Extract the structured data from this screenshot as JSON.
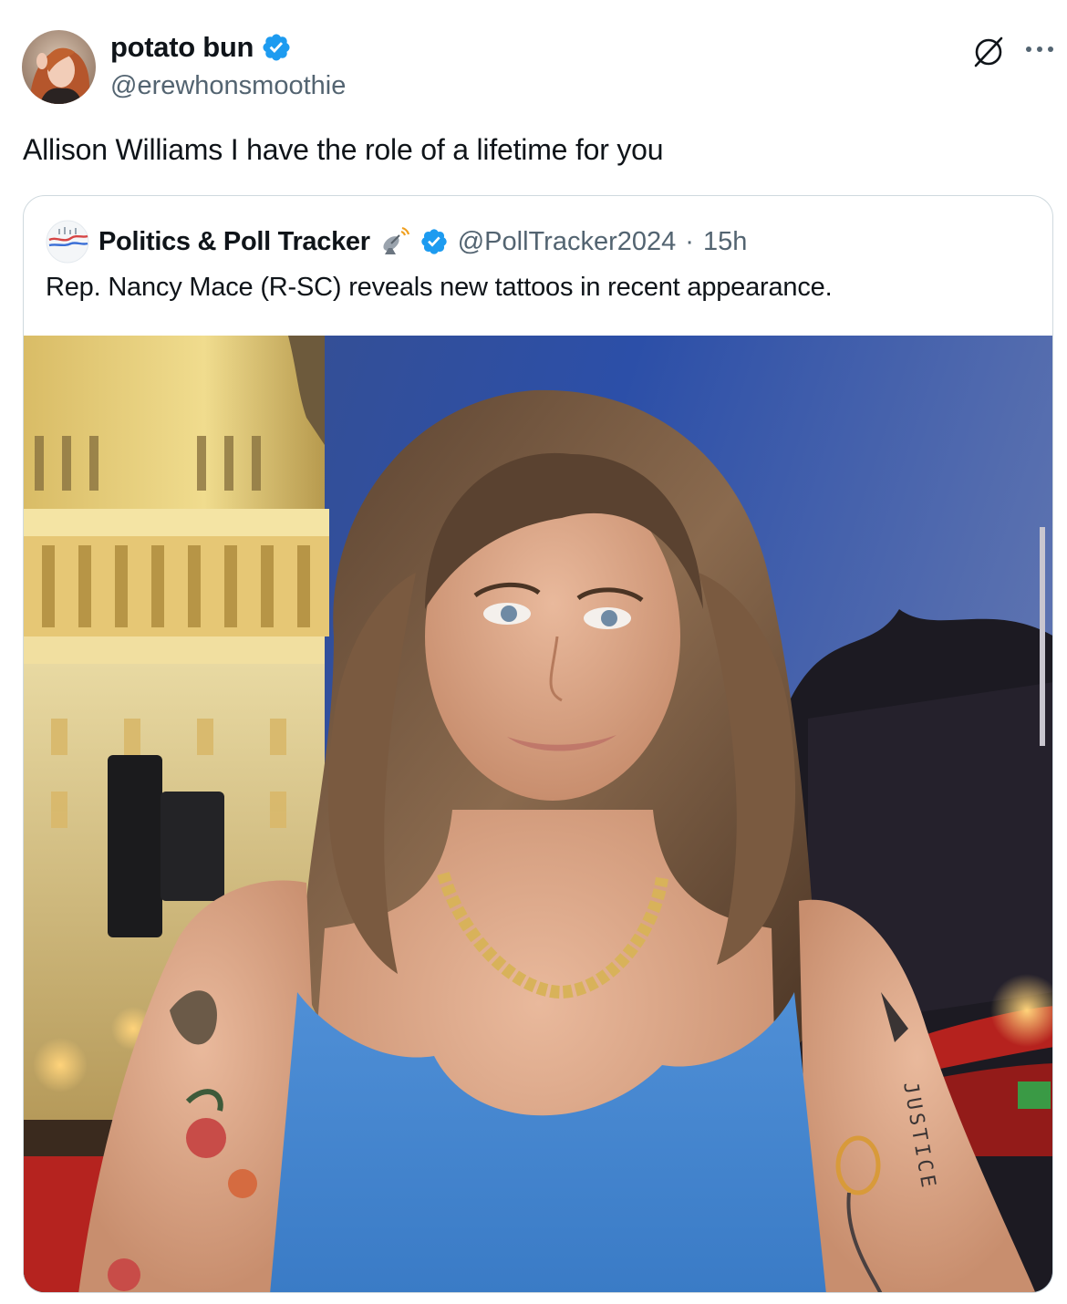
{
  "tweet": {
    "author": {
      "display_name": "potato bun",
      "handle": "@erewhonsmoothie",
      "avatar_icon": "avatar-photo",
      "verified_icon": "verified-badge-icon"
    },
    "text": "Allison Williams I have the role of a lifetime for you",
    "actions": {
      "grok_icon": "grok-icon",
      "more_icon": "more-icon"
    }
  },
  "quote": {
    "author": {
      "display_name": "Politics & Poll Tracker",
      "emoji_icon": "satellite-antenna-icon",
      "handle": "@PollTracker2024",
      "separator": "·",
      "time": "15h"
    },
    "text": "Rep. Nancy Mace (R-SC) reveals new tattoos in recent appearance.",
    "media": {
      "description_icon": "photo",
      "arm_tattoo_text": "JUSTICE"
    }
  },
  "colors": {
    "verified_blue": "#1d9bf0",
    "text_primary": "#0f1419",
    "text_secondary": "#536471",
    "border": "#cfd9de"
  }
}
